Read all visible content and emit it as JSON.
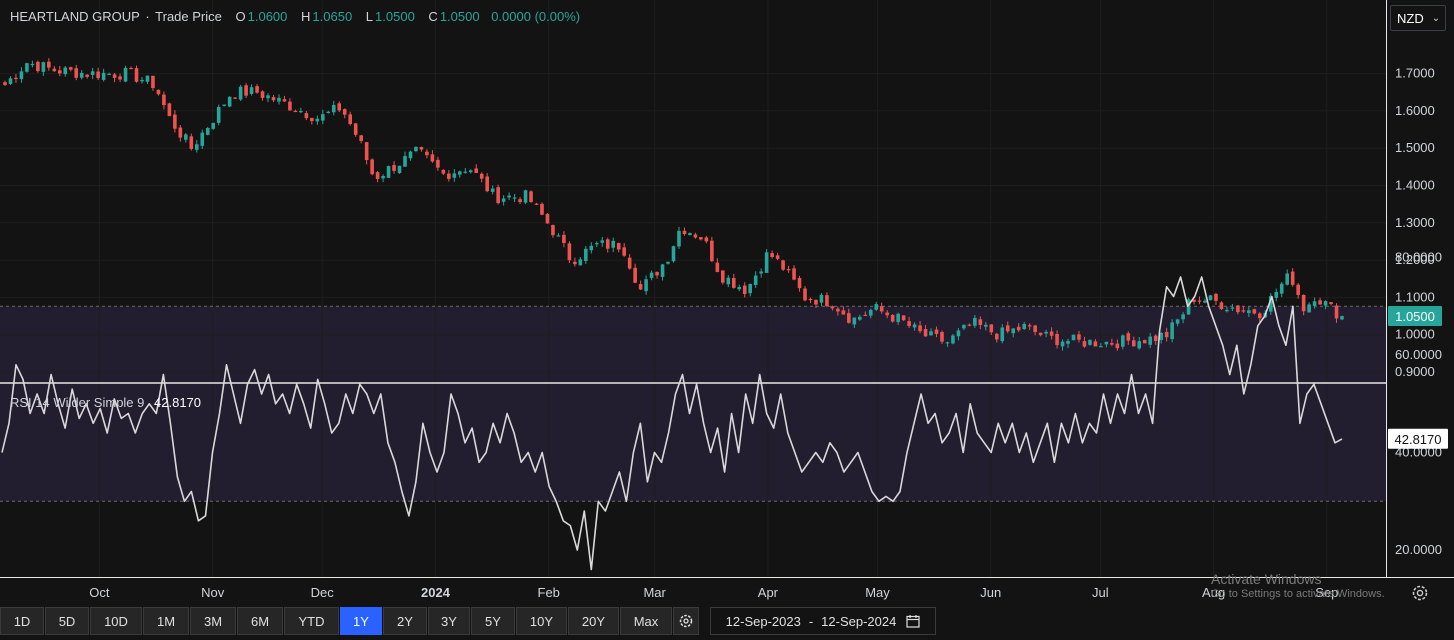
{
  "header": {
    "name": "HEARTLAND GROUP",
    "sep": "·",
    "series": "Trade Price",
    "o_label": "O",
    "o_value": "1.0600",
    "h_label": "H",
    "h_value": "1.0650",
    "l_label": "L",
    "l_value": "1.0500",
    "c_label": "C",
    "c_value": "1.0500",
    "change": "0.0000 (0.00%)"
  },
  "currency": {
    "value": "NZD",
    "chevron_icon": "chevron-down-icon"
  },
  "rsi_header": {
    "label": "RSI 14 Wilder Simple 9",
    "value": "42.8170"
  },
  "colors": {
    "up": "#26a69a",
    "down": "#ef5350",
    "background": "#131313",
    "rsi_line": "#d9d9d9",
    "rsi_band": "#221d2f",
    "last_price": "#26a69a"
  },
  "toolbar": {
    "ranges": [
      "1D",
      "5D",
      "10D",
      "1M",
      "3M",
      "6M",
      "YTD",
      "1Y",
      "2Y",
      "3Y",
      "5Y",
      "10Y",
      "20Y",
      "Max"
    ],
    "active": "1Y",
    "settings_icon": "gear-icon"
  },
  "date_range": {
    "start": "12-Sep-2023",
    "sep": "-",
    "end": "12-Sep-2024",
    "icon": "calendar-icon"
  },
  "watermark": {
    "line1": "Activate Windows",
    "line2": "Go to Settings to activate Windows."
  },
  "chart_data": [
    {
      "type": "candlestick",
      "title": "HEARTLAND GROUP · Trade Price",
      "x_range": [
        "12-Sep-2023",
        "12-Sep-2024"
      ],
      "x_ticks": [
        "Oct",
        "Nov",
        "Dec",
        "2024",
        "Feb",
        "Mar",
        "Apr",
        "May",
        "Jun",
        "Jul",
        "Aug",
        "Sep"
      ],
      "y_ticks": [
        "1.7000",
        "1.6000",
        "1.5000",
        "1.4000",
        "1.3000",
        "1.2000",
        "1.1000",
        "1.0000",
        "0.9000"
      ],
      "ylim": [
        0.9,
        1.75
      ],
      "last_price": "1.0500",
      "grid": true,
      "close_waypoints": [
        {
          "date": "2023-09-12",
          "close": 1.67
        },
        {
          "date": "2023-09-18",
          "close": 1.73
        },
        {
          "date": "2023-09-25",
          "close": 1.71
        },
        {
          "date": "2023-10-05",
          "close": 1.7
        },
        {
          "date": "2023-10-16",
          "close": 1.7
        },
        {
          "date": "2023-10-23",
          "close": 1.67
        },
        {
          "date": "2023-10-27",
          "close": 1.58
        },
        {
          "date": "2023-11-02",
          "close": 1.5
        },
        {
          "date": "2023-11-08",
          "close": 1.58
        },
        {
          "date": "2023-11-13",
          "close": 1.65
        },
        {
          "date": "2023-11-20",
          "close": 1.65
        },
        {
          "date": "2023-11-30",
          "close": 1.61
        },
        {
          "date": "2023-12-07",
          "close": 1.58
        },
        {
          "date": "2023-12-13",
          "close": 1.61
        },
        {
          "date": "2023-12-18",
          "close": 1.52
        },
        {
          "date": "2023-12-22",
          "close": 1.42
        },
        {
          "date": "2024-01-03",
          "close": 1.49
        },
        {
          "date": "2024-01-10",
          "close": 1.43
        },
        {
          "date": "2024-01-17",
          "close": 1.45
        },
        {
          "date": "2024-01-24",
          "close": 1.37
        },
        {
          "date": "2024-02-02",
          "close": 1.37
        },
        {
          "date": "2024-02-09",
          "close": 1.28
        },
        {
          "date": "2024-02-14",
          "close": 1.2
        },
        {
          "date": "2024-02-21",
          "close": 1.24
        },
        {
          "date": "2024-02-28",
          "close": 1.24
        },
        {
          "date": "2024-03-04",
          "close": 1.12
        },
        {
          "date": "2024-03-11",
          "close": 1.2
        },
        {
          "date": "2024-03-15",
          "close": 1.29
        },
        {
          "date": "2024-03-21",
          "close": 1.26
        },
        {
          "date": "2024-03-26",
          "close": 1.16
        },
        {
          "date": "2024-04-02",
          "close": 1.12
        },
        {
          "date": "2024-04-08",
          "close": 1.22
        },
        {
          "date": "2024-04-12",
          "close": 1.18
        },
        {
          "date": "2024-04-18",
          "close": 1.1
        },
        {
          "date": "2024-04-25",
          "close": 1.09
        },
        {
          "date": "2024-05-01",
          "close": 1.04
        },
        {
          "date": "2024-05-07",
          "close": 1.07
        },
        {
          "date": "2024-05-14",
          "close": 1.04
        },
        {
          "date": "2024-05-20",
          "close": 1.0
        },
        {
          "date": "2024-05-27",
          "close": 0.98
        },
        {
          "date": "2024-06-03",
          "close": 1.03
        },
        {
          "date": "2024-06-10",
          "close": 1.0
        },
        {
          "date": "2024-06-17",
          "close": 1.02
        },
        {
          "date": "2024-06-24",
          "close": 0.99
        },
        {
          "date": "2024-07-03",
          "close": 0.98
        },
        {
          "date": "2024-07-12",
          "close": 0.98
        },
        {
          "date": "2024-07-22",
          "close": 0.99
        },
        {
          "date": "2024-07-26",
          "close": 1.0
        },
        {
          "date": "2024-07-30",
          "close": 1.05
        },
        {
          "date": "2024-08-02",
          "close": 1.1
        },
        {
          "date": "2024-08-08",
          "close": 1.09
        },
        {
          "date": "2024-08-14",
          "close": 1.07
        },
        {
          "date": "2024-08-21",
          "close": 1.06
        },
        {
          "date": "2024-08-26",
          "close": 1.13
        },
        {
          "date": "2024-08-29",
          "close": 1.16
        },
        {
          "date": "2024-09-02",
          "close": 1.06
        },
        {
          "date": "2024-09-04",
          "close": 1.11
        },
        {
          "date": "2024-09-09",
          "close": 1.07
        },
        {
          "date": "2024-09-12",
          "close": 1.05
        }
      ]
    },
    {
      "type": "line",
      "title": "RSI 14 Wilder Simple 9",
      "y_ticks": [
        "80.0000",
        "60.0000",
        "40.0000",
        "20.0000"
      ],
      "ylim": [
        14,
        83
      ],
      "bands": [
        30,
        70
      ],
      "last_value": "42.8170",
      "series": [
        {
          "values": [
            40,
            46,
            58,
            55,
            48,
            52,
            48,
            56,
            50,
            45,
            53,
            47,
            50,
            46,
            49,
            44,
            51,
            47,
            48,
            44,
            48,
            50,
            48,
            56,
            46,
            35,
            30,
            32,
            26,
            27,
            40,
            48,
            58,
            52,
            46,
            54,
            57,
            52,
            56,
            50,
            52,
            48,
            54,
            50,
            45,
            55,
            50,
            44,
            46,
            52,
            48,
            54,
            52,
            48,
            52,
            42,
            38,
            32,
            27,
            34,
            46,
            40,
            36,
            40,
            52,
            48,
            42,
            45,
            38,
            40,
            46,
            42,
            48,
            44,
            38,
            40,
            36,
            40,
            33,
            30,
            26,
            25,
            20,
            28,
            16,
            30,
            28,
            32,
            36,
            30,
            40,
            46,
            34,
            40,
            38,
            44,
            52,
            56,
            48,
            54,
            46,
            40,
            45,
            36,
            48,
            40,
            52,
            46,
            56,
            48,
            45,
            52,
            44,
            40,
            36,
            38,
            40,
            38,
            42,
            40,
            36,
            38,
            40,
            36,
            32,
            30,
            31,
            30,
            32,
            40,
            46,
            52,
            46,
            48,
            42,
            44,
            48,
            40,
            50,
            44,
            42,
            40,
            46,
            42,
            46,
            40,
            44,
            38,
            42,
            46,
            38,
            46,
            42,
            48,
            42,
            46,
            44,
            52,
            46,
            52,
            48,
            56,
            48,
            52,
            46,
            65,
            74,
            72,
            76,
            70,
            72,
            76,
            70,
            66,
            62,
            56,
            62,
            52,
            58,
            66,
            68,
            72,
            66,
            62,
            70,
            46,
            52,
            54,
            50,
            46,
            42,
            42.8
          ]
        }
      ]
    }
  ]
}
